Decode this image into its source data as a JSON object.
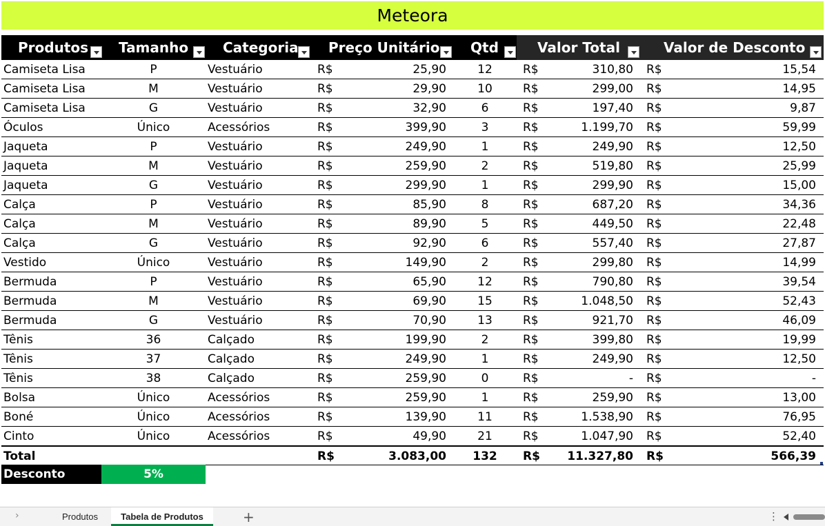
{
  "title": "Meteora",
  "columns": [
    {
      "label": "Produtos"
    },
    {
      "label": "Tamanho"
    },
    {
      "label": "Categoria"
    },
    {
      "label": "Preço Unitário"
    },
    {
      "label": "Qtd"
    },
    {
      "label": "Valor Total"
    },
    {
      "label": "Valor de Desconto"
    }
  ],
  "currency": "R$",
  "rows": [
    {
      "produto": "Camiseta Lisa",
      "tamanho": "P",
      "categoria": "Vestuário",
      "preco": "25,90",
      "qtd": "12",
      "total": "310,80",
      "desconto": "15,54"
    },
    {
      "produto": "Camiseta Lisa",
      "tamanho": "M",
      "categoria": "Vestuário",
      "preco": "29,90",
      "qtd": "10",
      "total": "299,00",
      "desconto": "14,95"
    },
    {
      "produto": "Camiseta Lisa",
      "tamanho": "G",
      "categoria": "Vestuário",
      "preco": "32,90",
      "qtd": "6",
      "total": "197,40",
      "desconto": "9,87"
    },
    {
      "produto": "Óculos",
      "tamanho": "Único",
      "categoria": "Acessórios",
      "preco": "399,90",
      "qtd": "3",
      "total": "1.199,70",
      "desconto": "59,99"
    },
    {
      "produto": "Jaqueta",
      "tamanho": "P",
      "categoria": "Vestuário",
      "preco": "249,90",
      "qtd": "1",
      "total": "249,90",
      "desconto": "12,50"
    },
    {
      "produto": "Jaqueta",
      "tamanho": "M",
      "categoria": "Vestuário",
      "preco": "259,90",
      "qtd": "2",
      "total": "519,80",
      "desconto": "25,99"
    },
    {
      "produto": "Jaqueta",
      "tamanho": "G",
      "categoria": "Vestuário",
      "preco": "299,90",
      "qtd": "1",
      "total": "299,90",
      "desconto": "15,00"
    },
    {
      "produto": "Calça",
      "tamanho": "P",
      "categoria": "Vestuário",
      "preco": "85,90",
      "qtd": "8",
      "total": "687,20",
      "desconto": "34,36"
    },
    {
      "produto": "Calça",
      "tamanho": "M",
      "categoria": "Vestuário",
      "preco": "89,90",
      "qtd": "5",
      "total": "449,50",
      "desconto": "22,48"
    },
    {
      "produto": "Calça",
      "tamanho": "G",
      "categoria": "Vestuário",
      "preco": "92,90",
      "qtd": "6",
      "total": "557,40",
      "desconto": "27,87"
    },
    {
      "produto": "Vestido",
      "tamanho": "Único",
      "categoria": "Vestuário",
      "preco": "149,90",
      "qtd": "2",
      "total": "299,80",
      "desconto": "14,99"
    },
    {
      "produto": "Bermuda",
      "tamanho": "P",
      "categoria": "Vestuário",
      "preco": "65,90",
      "qtd": "12",
      "total": "790,80",
      "desconto": "39,54"
    },
    {
      "produto": "Bermuda",
      "tamanho": "M",
      "categoria": "Vestuário",
      "preco": "69,90",
      "qtd": "15",
      "total": "1.048,50",
      "desconto": "52,43"
    },
    {
      "produto": "Bermuda",
      "tamanho": "G",
      "categoria": "Vestuário",
      "preco": "70,90",
      "qtd": "13",
      "total": "921,70",
      "desconto": "46,09"
    },
    {
      "produto": "Tênis",
      "tamanho": "36",
      "categoria": "Calçado",
      "preco": "199,90",
      "qtd": "2",
      "total": "399,80",
      "desconto": "19,99"
    },
    {
      "produto": "Tênis",
      "tamanho": "37",
      "categoria": "Calçado",
      "preco": "249,90",
      "qtd": "1",
      "total": "249,90",
      "desconto": "12,50"
    },
    {
      "produto": "Tênis",
      "tamanho": "38",
      "categoria": "Calçado",
      "preco": "259,90",
      "qtd": "0",
      "total": "-",
      "desconto": "-"
    },
    {
      "produto": "Bolsa",
      "tamanho": "Único",
      "categoria": "Acessórios",
      "preco": "259,90",
      "qtd": "1",
      "total": "259,90",
      "desconto": "13,00"
    },
    {
      "produto": "Boné",
      "tamanho": "Único",
      "categoria": "Acessórios",
      "preco": "139,90",
      "qtd": "11",
      "total": "1.538,90",
      "desconto": "76,95"
    },
    {
      "produto": "Cinto",
      "tamanho": "Único",
      "categoria": "Acessórios",
      "preco": "49,90",
      "qtd": "21",
      "total": "1.047,90",
      "desconto": "52,40"
    }
  ],
  "totals": {
    "label": "Total",
    "preco": "3.083,00",
    "qtd": "132",
    "total": "11.327,80",
    "desconto": "566,39"
  },
  "discount": {
    "label": "Desconto",
    "value": "5%"
  },
  "sheet_tabs": [
    {
      "label": "Produtos",
      "active": false
    },
    {
      "label": "Tabela de Produtos",
      "active": true
    }
  ],
  "colors": {
    "title_bg": "#d6ff3e",
    "header_bg": "#000000",
    "discount_bg": "#00b050",
    "active_tab_underline": "#107c41"
  },
  "icons": {
    "nav": "chevron-right-icon",
    "add": "plus-icon",
    "more": "vertical-dots-icon",
    "filter": "filter-dropdown-icon"
  }
}
